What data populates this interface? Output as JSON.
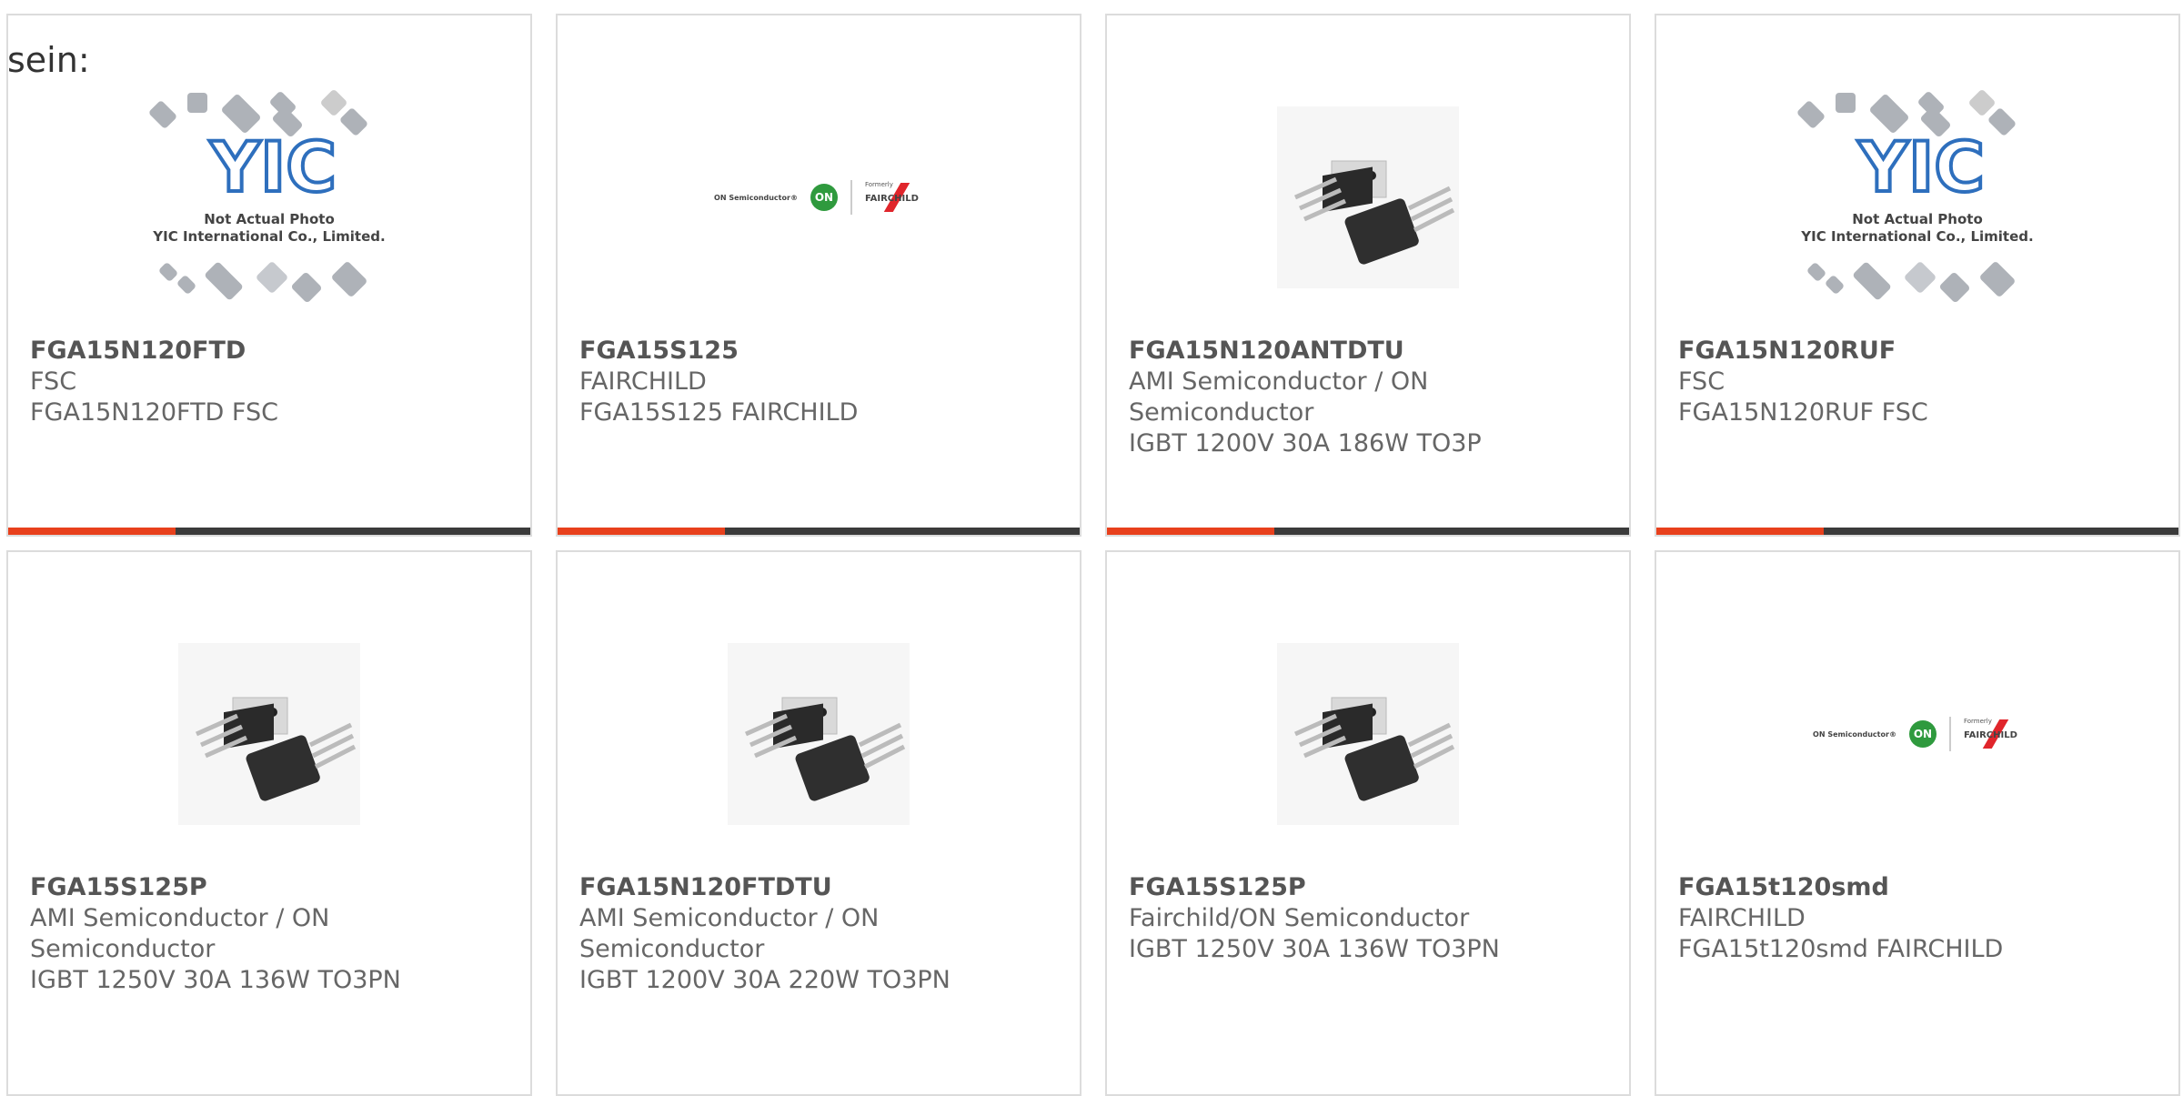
{
  "lead_text": "sein:",
  "colors": {
    "accent": "#e8401c",
    "bar": "#3b3b3b",
    "border": "#dcdcdc"
  },
  "products": [
    {
      "part": "FGA15N120FTD",
      "maker": "FSC",
      "desc": "FGA15N120FTD FSC",
      "image": "yic-placeholder",
      "placeholder_caption_1": "Not Actual Photo",
      "placeholder_caption_2": "YIC International Co., Limited."
    },
    {
      "part": "FGA15S125",
      "maker": "FAIRCHILD",
      "desc": "FGA15S125 FAIRCHILD",
      "image": "on-fairchild-logo"
    },
    {
      "part": "FGA15N120ANTDTU",
      "maker": "AMI Semiconductor / ON Semiconductor",
      "desc": "IGBT 1200V 30A 186W TO3P",
      "image": "to3p-package"
    },
    {
      "part": "FGA15N120RUF",
      "maker": "FSC",
      "desc": "FGA15N120RUF FSC",
      "image": "yic-placeholder",
      "placeholder_caption_1": "Not Actual Photo",
      "placeholder_caption_2": "YIC International Co., Limited."
    },
    {
      "part": "FGA15S125P",
      "maker": "AMI Semiconductor / ON Semiconductor",
      "desc": "IGBT 1250V 30A 136W TO3PN",
      "image": "to3p-package"
    },
    {
      "part": "FGA15N120FTDTU",
      "maker": "AMI Semiconductor / ON Semiconductor",
      "desc": "IGBT 1200V 30A 220W TO3PN",
      "image": "to3p-package"
    },
    {
      "part": "FGA15S125P",
      "maker": "Fairchild/ON Semiconductor",
      "desc": "IGBT 1250V 30A 136W TO3PN",
      "image": "to3p-package"
    },
    {
      "part": "FGA15t120smd",
      "maker": "FAIRCHILD",
      "desc": "FGA15t120smd FAIRCHILD",
      "image": "on-fairchild-logo"
    }
  ],
  "logo_text": {
    "on_semi": "ON Semiconductor®",
    "on": "ON",
    "formerly": "Formerly",
    "fairchild": "FAIRCHILD",
    "yic": "YIC"
  }
}
